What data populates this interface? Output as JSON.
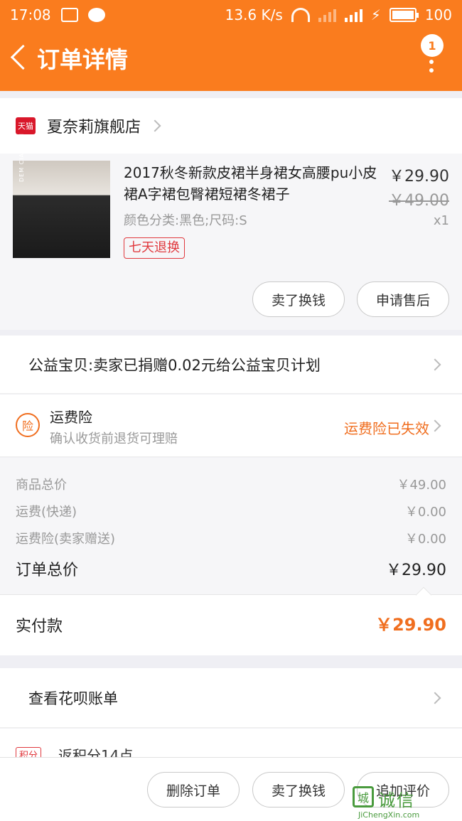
{
  "status_bar": {
    "time": "17:08",
    "speed": "13.6 K/s",
    "battery": "100"
  },
  "header": {
    "title": "订单详情",
    "badge_count": "1"
  },
  "shop": {
    "logo_text": "天猫",
    "name": "夏奈莉旗舰店"
  },
  "product": {
    "image_text": "DEM CIAVELIN",
    "title": "2017秋冬新款皮裙半身裙女高腰pu小皮裙A字裙包臀裙短裙冬裙子",
    "attributes": "颜色分类:黑色;尺码:S",
    "tag": "七天退换",
    "price": "￥29.90",
    "original_price": "￥49.00",
    "quantity": "x1",
    "buttons": [
      "卖了换钱",
      "申请售后"
    ]
  },
  "charity": {
    "text": "公益宝贝:卖家已捐赠0.02元给公益宝贝计划"
  },
  "insurance": {
    "icon_text": "险",
    "title": "运费险",
    "subtitle": "确认收货前退货可理赔",
    "status": "运费险已失效"
  },
  "summary": {
    "goods_label": "商品总价",
    "goods_value": "￥49.00",
    "shipping_label": "运费(快递)",
    "shipping_value": "￥0.00",
    "insurance_label": "运费险(卖家赠送)",
    "insurance_value": "￥0.00",
    "total_label": "订单总价",
    "total_value": "￥29.90"
  },
  "paid": {
    "label": "实付款",
    "value": "￥29.90"
  },
  "huabei": {
    "text": "查看花呗账单"
  },
  "points": {
    "tag": "积分",
    "text": "返积分14点"
  },
  "bottom_bar": {
    "delete": "删除订单",
    "sell": "卖了换钱",
    "review": "追加评价"
  },
  "watermark": {
    "logo": "城",
    "brand": "诚信",
    "url": "JiChengXin.com"
  },
  "colors": {
    "header": "#fa7c1e",
    "accent": "#f06e1f",
    "tmall_red": "#d9172a"
  }
}
